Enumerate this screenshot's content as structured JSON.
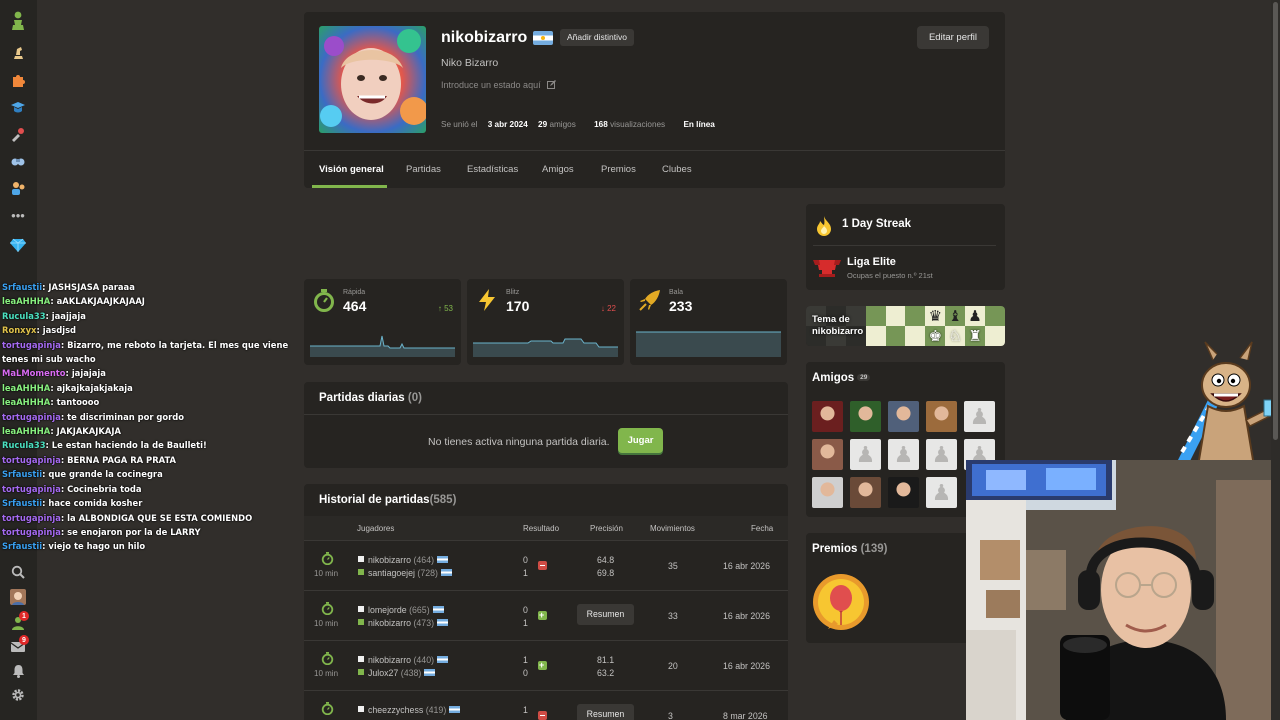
{
  "rail": {
    "icons": [
      "chess-pawn-logo-icon",
      "play-icon",
      "puzzles-icon",
      "learn-icon",
      "watch-icon",
      "community-icon",
      "social-icon",
      "more-icon",
      "diamond-icon",
      "search-icon",
      "profile-avatar-icon",
      "friends-icon",
      "messages-icon",
      "notifications-icon",
      "settings-icon"
    ],
    "badges": {
      "friends": "1",
      "messages": "9"
    }
  },
  "chat": [
    {
      "user": "Srfaustii",
      "color": "#3aa1f2",
      "text": "JASHSJASA paraaa"
    },
    {
      "user": "leaAHHHA",
      "color": "#88f07f",
      "text": "aAKLAKJAAJKAJAAJ"
    },
    {
      "user": "Rucula33",
      "color": "#4be0c0",
      "text": "jaajjaja"
    },
    {
      "user": "Ronxyx",
      "color": "#e0c24b",
      "text": "jasdjsd"
    },
    {
      "user": "tortugapinja",
      "color": "#a66bf2",
      "text": "Bizarro, me reboto la tarjeta. El mes que viene tenes mi sub wacho"
    },
    {
      "user": "MaLMomento",
      "color": "#d96bf2",
      "text": "jajajaja"
    },
    {
      "user": "leaAHHHA",
      "color": "#88f07f",
      "text": "ajkajkajakjakaja"
    },
    {
      "user": "leaAHHHA",
      "color": "#88f07f",
      "text": "tantoooo"
    },
    {
      "user": "tortugapinja",
      "color": "#a66bf2",
      "text": "te discriminan por gordo"
    },
    {
      "user": "leaAHHHA",
      "color": "#88f07f",
      "text": "JAKJAKAJKAJA"
    },
    {
      "user": "Rucula33",
      "color": "#4be0c0",
      "text": "Le estan haciendo la de Baulleti!"
    },
    {
      "user": "tortugapinja",
      "color": "#a66bf2",
      "text": "BERNA PAGA RA PRATA"
    },
    {
      "user": "Srfaustii",
      "color": "#3aa1f2",
      "text": "que grande la cocinegra"
    },
    {
      "user": "tortugapinja",
      "color": "#a66bf2",
      "text": "Cocinebria toda"
    },
    {
      "user": "Srfaustii",
      "color": "#3aa1f2",
      "text": "hace comida kosher"
    },
    {
      "user": "tortugapinja",
      "color": "#a66bf2",
      "text": "la ALBONDIGA QUE SE ESTA COMIENDO"
    },
    {
      "user": "tortugapinja",
      "color": "#a66bf2",
      "text": "se enojaron por la de LARRY"
    },
    {
      "user": "Srfaustii",
      "color": "#3aa1f2",
      "text": "viejo te hago un hilo"
    }
  ],
  "profile": {
    "username": "nikobizarro",
    "add_badge": "Añadir distintivo",
    "edit_profile": "Editar perfil",
    "real_name": "Niko Bizarro",
    "status_placeholder": "Introduce un estado aquí",
    "joined_label": "Se unió el",
    "joined_date": "3 abr 2024",
    "friends_count": "29",
    "friends_label": "amigos",
    "views_count": "168",
    "views_label": "visualizaciones",
    "online": "En línea",
    "tabs": [
      "Visión general",
      "Partidas",
      "Estadísticas",
      "Amigos",
      "Premios",
      "Clubes"
    ]
  },
  "ratings": [
    {
      "label": "Rápida",
      "value": "464",
      "delta": "53",
      "direction": "up",
      "icon": "rapid-clock-icon",
      "color": "#81b64c"
    },
    {
      "label": "Blitz",
      "value": "170",
      "delta": "22",
      "direction": "down",
      "icon": "blitz-lightning-icon",
      "color": "#f7c631"
    },
    {
      "label": "Bala",
      "value": "233",
      "delta": "",
      "direction": "none",
      "icon": "bullet-icon",
      "color": "#e3aa24"
    }
  ],
  "daily": {
    "title": "Partidas diarias",
    "count": "(0)",
    "empty_text": "No tienes activa ninguna partida diaria.",
    "play_button": "Jugar"
  },
  "history": {
    "title": "Historial de partidas",
    "count": "(585)",
    "headers": {
      "players": "Jugadores",
      "result": "Resultado",
      "accuracy": "Precisión",
      "moves": "Movimientos",
      "date": "Fecha"
    },
    "rows": [
      {
        "time_control": "10 min",
        "white": "nikobizarro",
        "white_rating": "(464)",
        "black": "santiagoejej",
        "black_rating": "(728)",
        "white_score": "0",
        "black_score": "1",
        "result": "loss",
        "acc_white": "64.8",
        "acc_black": "69.8",
        "review": "",
        "moves": "35",
        "date": "16 abr 2026"
      },
      {
        "time_control": "10 min",
        "white": "lomejorde",
        "white_rating": "(665)",
        "black": "nikobizarro",
        "black_rating": "(473)",
        "white_score": "0",
        "black_score": "1",
        "result": "win",
        "acc_white": "",
        "acc_black": "",
        "review": "Resumen",
        "moves": "33",
        "date": "16 abr 2026"
      },
      {
        "time_control": "10 min",
        "white": "nikobizarro",
        "white_rating": "(440)",
        "black": "Julox27",
        "black_rating": "(438)",
        "white_score": "1",
        "black_score": "0",
        "result": "win",
        "acc_white": "81.1",
        "acc_black": "63.2",
        "review": "",
        "moves": "20",
        "date": "16 abr 2026"
      },
      {
        "time_control": "",
        "white": "cheezzychess",
        "white_rating": "(419)",
        "black": "",
        "black_rating": "",
        "white_score": "1",
        "black_score": "",
        "result": "loss",
        "acc_white": "",
        "acc_black": "",
        "review": "Resumen",
        "moves": "3",
        "date": "8 mar 2026"
      }
    ]
  },
  "streak": {
    "title": "1 Day Streak",
    "league": "Liga Elite",
    "league_sub": "Ocupas el puesto n.º 21st"
  },
  "theme": {
    "label_line1": "Tema de",
    "label_line2": "nikobizarro"
  },
  "friends": {
    "title": "Amigos",
    "count": "29"
  },
  "awards": {
    "title": "Premios",
    "count": "(139)"
  }
}
